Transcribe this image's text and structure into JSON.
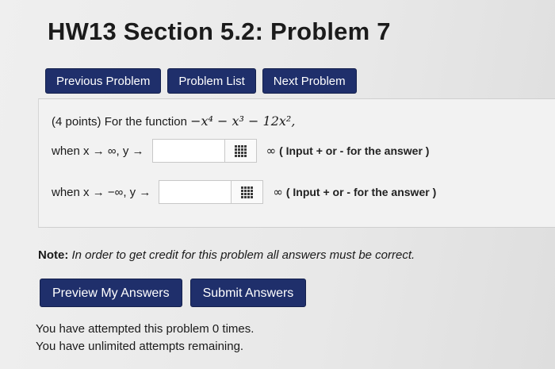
{
  "page": {
    "title": "HW13 Section 5.2: Problem 7"
  },
  "nav": {
    "previous": "Previous Problem",
    "list": "Problem List",
    "next": "Next Problem"
  },
  "problem": {
    "intro_prefix": "(4 points) For the function",
    "function_expr": "−x⁴ − x³ − 12x²,",
    "rows": [
      {
        "prefix": "when x → ∞, y →",
        "input_value": "",
        "infinity": "∞",
        "hint": "( Input + or - for the answer )"
      },
      {
        "prefix": "when x → −∞, y →",
        "input_value": "",
        "infinity": "∞",
        "hint": "( Input + or - for the answer )"
      }
    ]
  },
  "note": {
    "label": "Note:",
    "text": "In order to get credit for this problem all answers must be correct."
  },
  "actions": {
    "preview": "Preview My Answers",
    "submit": "Submit Answers"
  },
  "status": {
    "attempts": "You have attempted this problem 0 times.",
    "remaining": "You have unlimited attempts remaining."
  },
  "colors": {
    "button_bg": "#1f2f6b",
    "button_text": "#ffffff",
    "page_bg": "#e9e9e9"
  },
  "icons": {
    "keyboard": "keyboard-grid-icon"
  }
}
